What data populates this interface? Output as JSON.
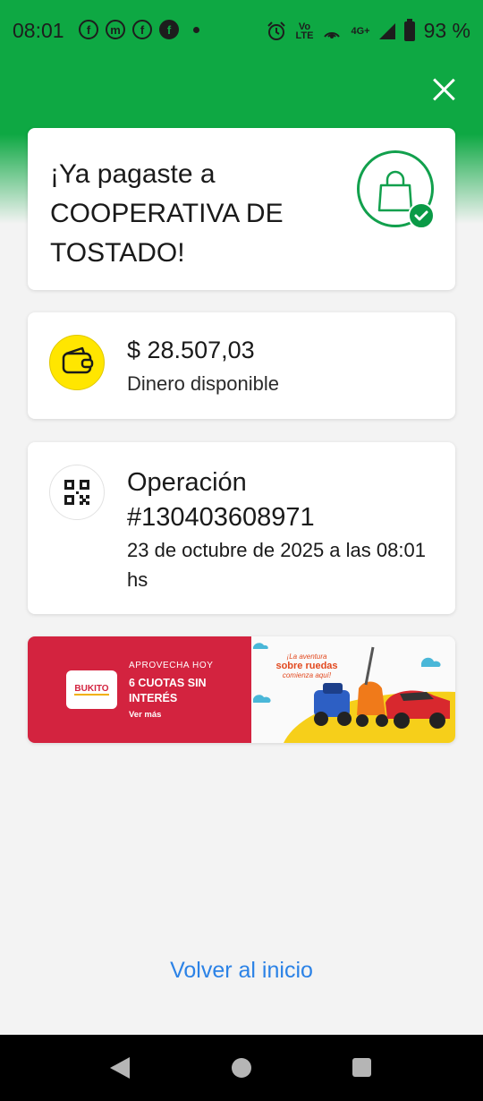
{
  "status_bar": {
    "time": "08:01",
    "icons": [
      "facebook-outline-icon",
      "messenger-icon",
      "facebook-outline-icon",
      "facebook-filled-icon",
      "notification-dot-icon"
    ],
    "alarm_icon": "alarm-icon",
    "volte_label_top": "Vo",
    "volte_label_bottom": "LTE",
    "network_label": "4G+",
    "battery_percent": "93 %"
  },
  "success": {
    "title": "¡Ya pagaste a COOPERATIVA DE TOSTADO!",
    "icon": "shopping-bag-check-icon"
  },
  "balance": {
    "amount": "$ 28.507,03",
    "label": "Dinero disponible",
    "icon": "wallet-icon"
  },
  "operation": {
    "title": "Operación #130403608971",
    "date": "23 de octubre de 2025 a las 08:01 hs",
    "icon": "qr-code-icon"
  },
  "banner": {
    "brand": "BUKITO",
    "line1": "APROVECHA HOY",
    "line2": "6 CUOTAS SIN INTERÉS",
    "line3": "Ver más",
    "promo_small_1": "¡La aventura",
    "promo_big": "sobre ruedas",
    "promo_small_2": "comienza aquí!"
  },
  "actions": {
    "home_link": "Volver al inicio"
  },
  "colors": {
    "brand_green": "#0ea843",
    "link_blue": "#2b82e6",
    "banner_red": "#d3233f",
    "wallet_yellow": "#ffe600"
  }
}
